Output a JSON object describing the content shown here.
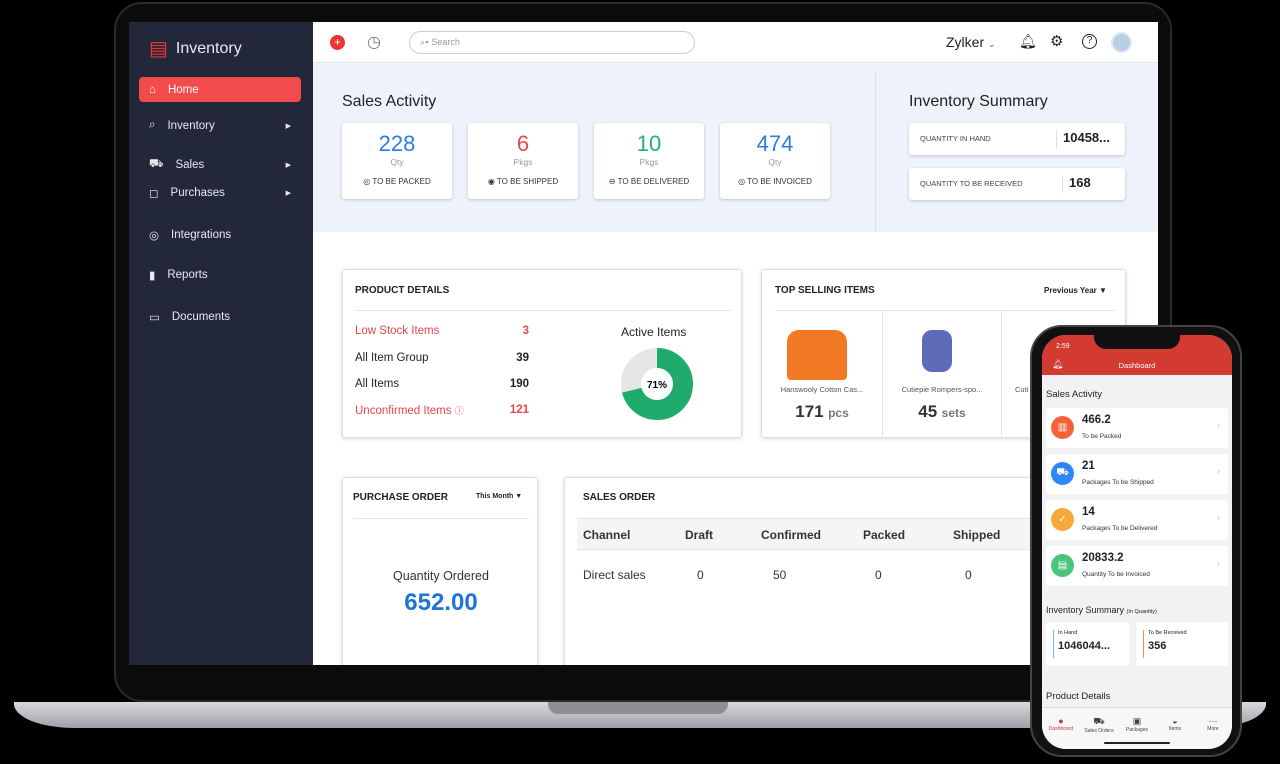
{
  "app": {
    "name": "Inventory",
    "org": "Zylker"
  },
  "sidebar": {
    "items": [
      {
        "label": "Home",
        "icon": "home-icon"
      },
      {
        "label": "Inventory",
        "icon": "tag-icon"
      },
      {
        "label": "Sales",
        "icon": "cart-icon"
      },
      {
        "label": "Purchases",
        "icon": "bag-icon"
      },
      {
        "label": "Integrations",
        "icon": "integration-icon"
      },
      {
        "label": "Reports",
        "icon": "chart-icon"
      },
      {
        "label": "Documents",
        "icon": "folder-icon"
      }
    ]
  },
  "topbar": {
    "search_placeholder": "Search"
  },
  "sales_activity": {
    "title": "Sales Activity",
    "cards": [
      {
        "value": "228",
        "unit": "Qty",
        "label": "TO BE PACKED",
        "color": "#2b7de1"
      },
      {
        "value": "6",
        "unit": "Pkgs",
        "label": "TO BE SHIPPED",
        "color": "#e8464b"
      },
      {
        "value": "10",
        "unit": "Pkgs",
        "label": "TO BE DELIVERED",
        "color": "#1fb36b"
      },
      {
        "value": "474",
        "unit": "Qty",
        "label": "TO BE INVOICED",
        "color": "#2b7de1"
      }
    ]
  },
  "inventory_summary": {
    "title": "Inventory Summary",
    "rows": [
      {
        "label": "QUANTITY IN HAND",
        "value": "10458..."
      },
      {
        "label": "QUANTITY TO BE RECEIVED",
        "value": "168"
      }
    ]
  },
  "product_details": {
    "title": "PRODUCT DETAILS",
    "rows": [
      {
        "label": "Low Stock Items",
        "value": "3"
      },
      {
        "label": "All Item Group",
        "value": "39"
      },
      {
        "label": "All Items",
        "value": "190"
      },
      {
        "label": "Unconfirmed Items",
        "value": "121"
      }
    ],
    "active_items_label": "Active Items",
    "active_percent": 71,
    "active_percent_label": "71%"
  },
  "top_selling": {
    "title": "TOP SELLING ITEMS",
    "period": "Previous Year",
    "items": [
      {
        "name": "Hanswooly Cotton Cas...",
        "qty": "171",
        "unit": "pcs"
      },
      {
        "name": "Cutiepie Rompers-spo...",
        "qty": "45",
        "unit": "sets"
      },
      {
        "name": "Cuti"
      }
    ]
  },
  "purchase_order": {
    "title": "PURCHASE ORDER",
    "period": "This Month",
    "label": "Quantity Ordered",
    "value": "652.00"
  },
  "sales_order": {
    "title": "SALES ORDER",
    "columns": [
      "Channel",
      "Draft",
      "Confirmed",
      "Packed",
      "Shipped"
    ],
    "rows": [
      [
        "Direct sales",
        "0",
        "50",
        "0",
        "0"
      ]
    ]
  },
  "phone": {
    "time": "2:59",
    "title": "Dashboard",
    "sales_title": "Sales Activity",
    "cards": [
      {
        "value": "466.2",
        "label": "To be Packed",
        "color": "#f4623a"
      },
      {
        "value": "21",
        "label": "Packages To be Shipped",
        "color": "#2f86f6"
      },
      {
        "value": "14",
        "label": "Packages To be Delivered",
        "color": "#f7a93b"
      },
      {
        "value": "20833.2",
        "label": "Quantity To be Invoiced",
        "color": "#4cc47a"
      }
    ],
    "inv_title": "Inventory Summary",
    "inv_sub": "(In Quantity)",
    "in_hand_label": "In Hand",
    "in_hand": "1046044...",
    "to_receive_label": "To Be Received",
    "to_receive": "356",
    "product_title": "Product Details",
    "tabs": [
      "Dashboard",
      "Sales Orders",
      "Packages",
      "Items",
      "More"
    ]
  }
}
